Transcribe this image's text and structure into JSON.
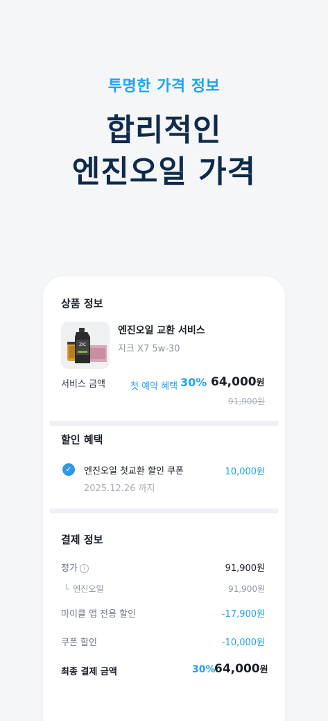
{
  "hero": {
    "subtitle": "투명한 가격 정보",
    "title_line1": "합리적인",
    "title_line2": "엔진오일 가격"
  },
  "product_section": {
    "title": "상품 정보",
    "product_name": "엔진오일 교환 서비스",
    "product_spec": "지크 X7 5w-30",
    "service_label": "서비스 금액",
    "first_booking_label": "첫 예약 혜택",
    "discount_percent": "30%",
    "price": "64,000",
    "price_unit": "원",
    "original_price": "91,900원"
  },
  "discount_section": {
    "title": "할인 혜택",
    "coupon_name": "엔진오일 첫교환 할인 쿠폰",
    "coupon_valid_until": "2025.12.26 까지",
    "coupon_amount": "10,000원",
    "coupon_checked": true
  },
  "payment_section": {
    "title": "결제 정보",
    "list_price_label": "정가",
    "list_price_value": "91,900원",
    "engine_oil_label": "엔진오일",
    "engine_oil_value": "91,900원",
    "app_discount_label": "마이클 앱 전용 할인",
    "app_discount_value": "-17,900원",
    "coupon_discount_label": "쿠폰 할인",
    "coupon_discount_value": "-10,000원",
    "final_label": "최종 결제 금액",
    "final_percent": "30%",
    "final_price": "64,000",
    "final_unit": "원"
  },
  "colors": {
    "accent": "#1ea3f0",
    "title": "#0f2a4a",
    "background": "#f4f6f8"
  }
}
